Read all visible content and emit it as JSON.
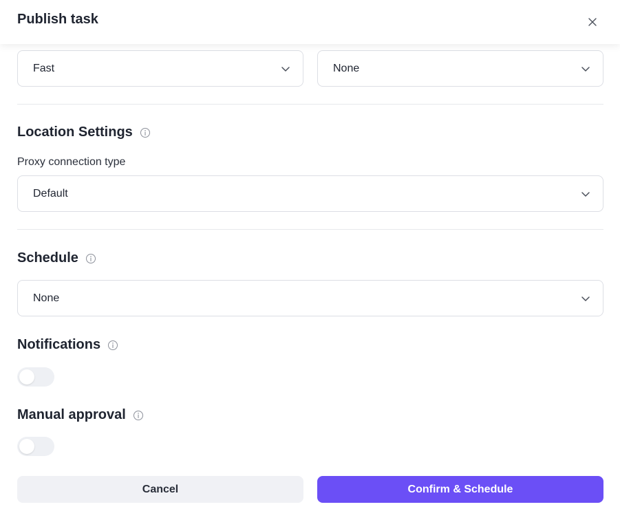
{
  "dialog": {
    "title": "Publish task"
  },
  "speed_select": {
    "value": "Fast"
  },
  "second_select": {
    "value": "None"
  },
  "location": {
    "heading": "Location Settings",
    "proxy_label": "Proxy connection type",
    "proxy_value": "Default"
  },
  "schedule": {
    "heading": "Schedule",
    "value": "None"
  },
  "notifications": {
    "heading": "Notifications",
    "enabled": false
  },
  "manual_approval": {
    "heading": "Manual approval",
    "enabled": false
  },
  "buttons": {
    "cancel": "Cancel",
    "confirm": "Confirm & Schedule"
  },
  "colors": {
    "accent": "#6b4ff6",
    "cancel_bg": "#f0f1f5",
    "toggle_off": "#eef0f4"
  },
  "icons": [
    "close-icon",
    "chevron-down-icon",
    "info-icon"
  ]
}
